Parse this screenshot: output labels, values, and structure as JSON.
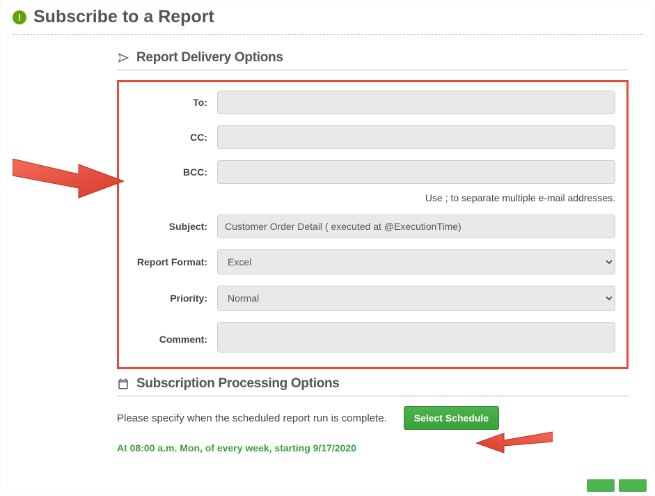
{
  "title": "Subscribe to a Report",
  "delivery": {
    "section_title": "Report Delivery Options",
    "labels": {
      "to": "To:",
      "cc": "CC:",
      "bcc": "BCC:",
      "subject": "Subject:",
      "format": "Report Format:",
      "priority": "Priority:",
      "comment": "Comment:"
    },
    "values": {
      "to": "",
      "cc": "",
      "bcc": "",
      "subject": "Customer Order Detail ( executed at @ExecutionTime)",
      "format": "Excel",
      "priority": "Normal",
      "comment": ""
    },
    "hint": "Use ; to separate multiple e-mail addresses."
  },
  "processing": {
    "section_title": "Subscription Processing Options",
    "instruction": "Please specify when the scheduled report run is complete.",
    "button": "Select Schedule",
    "schedule_text": "At 08:00 a.m. Mon, of every week, starting 9/17/2020"
  }
}
